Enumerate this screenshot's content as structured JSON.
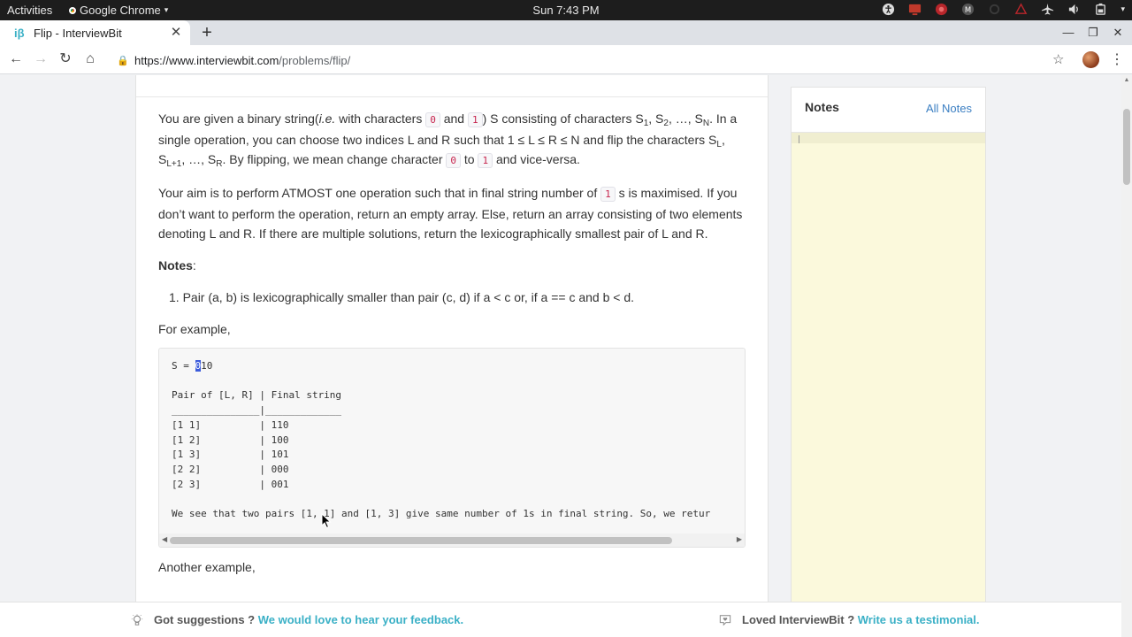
{
  "system_bar": {
    "activities": "Activities",
    "app_name": "Google Chrome",
    "clock": "Sun  7:43 PM"
  },
  "browser": {
    "tab_title": "Flip - InterviewBit",
    "tab_favicon": "iβ",
    "url_host": "https://www.interviewbit.com",
    "url_path": "/problems/flip/"
  },
  "problem": {
    "p1": {
      "t1": "You are given a binary string(",
      "ie": "i.e.",
      "t2": " with characters ",
      "c0": "0",
      "and": " and ",
      "c1": "1",
      "t3": ") S consisting of characters S",
      "s1": "1",
      "t4": ", S",
      "s2": "2",
      "t5": ", …, S",
      "sN": "N",
      "t6": ". In a single operation, you can choose two indices L and R such that 1 ≤ L ≤ R ≤ N and flip the characters S",
      "sL": "L",
      "t7": ", S",
      "sL1": "L+1",
      "t8": ", …, S",
      "sR": "R",
      "t9": ". By flipping, we mean change character ",
      "c0b": "0",
      "to": " to ",
      "c1b": "1",
      "t10": " and vice-versa."
    },
    "p2": {
      "t1": "Your aim is to perform ATMOST one operation such that in final string number of ",
      "c1": "1",
      "t2": " s is maximised. If you don’t want to perform the operation, return an empty array. Else, return an array consisting of two elements denoting L and R. If there are multiple solutions, return the lexicographically smallest pair of L and R."
    },
    "notes_label": "Notes",
    "notes_colon": ":",
    "note_item": "1. Pair (a, b) is lexicographically smaller than pair (c, d) if a < c or, if a == c and b < d.",
    "for_example": "For example,",
    "code": {
      "s_prefix": "S = ",
      "s_highlight": "0",
      "s_rest": "10",
      "header": "Pair of [L, R] | Final string",
      "rule": "_______________|_____________",
      "rows": [
        "[1 1]          | 110",
        "[1 2]          | 100",
        "[1 3]          | 101",
        "[2 2]          | 000",
        "[2 3]          | 001"
      ],
      "footer": "We see that two pairs [1, 1] and [1, 3] give same number of 1s in final string. So, we retur"
    },
    "another_example": "Another example,"
  },
  "notes_panel": {
    "title": "Notes",
    "all_notes": "All Notes"
  },
  "feedback": {
    "left_text": "Got suggestions ?",
    "left_link": "We would love to hear your feedback.",
    "right_text": "Loved InterviewBit ?",
    "right_link": "Write us a testimonial."
  }
}
